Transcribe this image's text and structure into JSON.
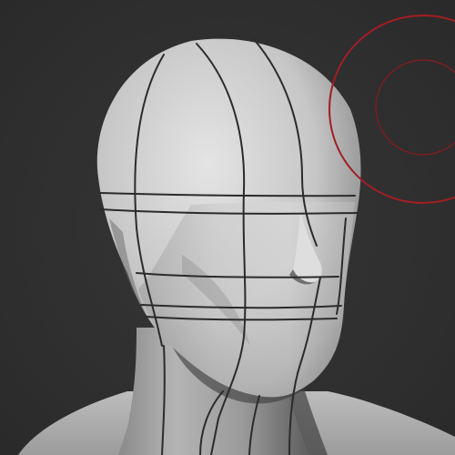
{
  "viewport": {
    "background_color": "#2f2f2f"
  },
  "model": {
    "name": "",
    "surface_color": "#d4d4d4",
    "shadow_color": "#6a6a6a",
    "guide_line_color": "#2b2b2b"
  },
  "brush_cursor": {
    "icon": "brush-circle-cursor",
    "outer_color": "#a01e24",
    "inner_color": "#8a1a20"
  }
}
